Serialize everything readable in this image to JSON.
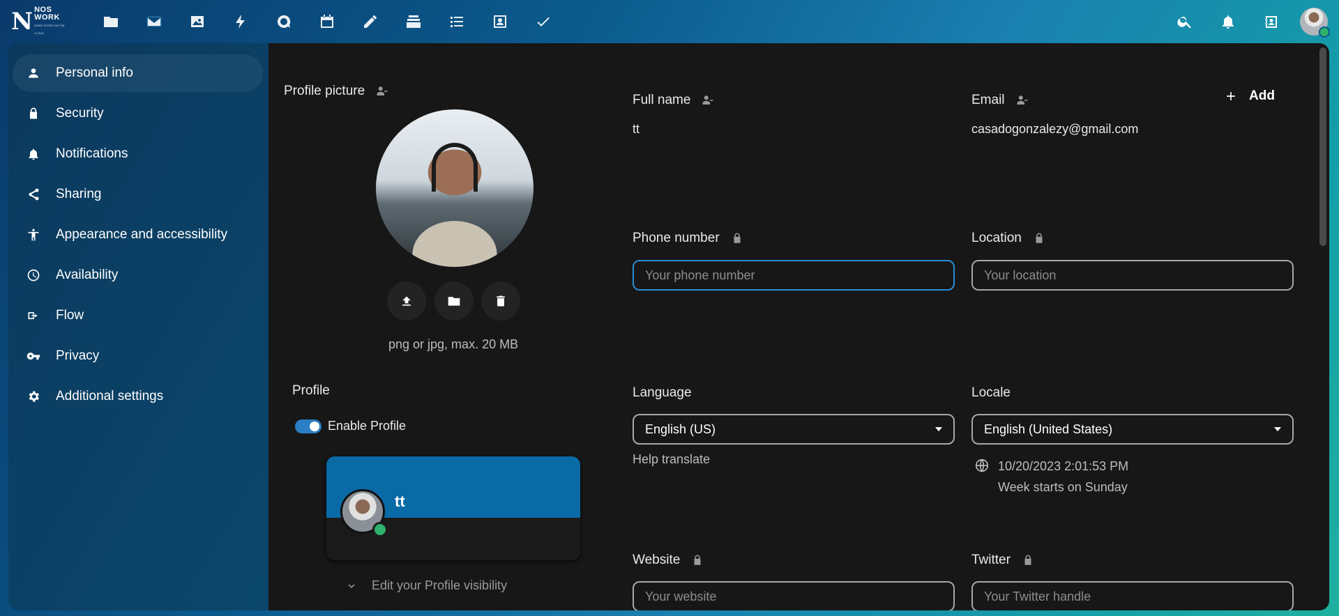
{
  "brand": {
    "logo_letter": "N",
    "logo_line1": "NOS",
    "logo_line2": "WORK",
    "logo_tagline": "WORK STORE ON THE CLOUD"
  },
  "top_apps": [
    "files-icon",
    "mail-icon",
    "photos-icon",
    "activity-icon",
    "talk-icon",
    "calendar-icon",
    "notes-icon",
    "deck-icon",
    "tasks-icon",
    "contacts-icon",
    "checkmark-icon"
  ],
  "nav": {
    "items": [
      {
        "label": "Personal info",
        "icon": "person-icon"
      },
      {
        "label": "Security",
        "icon": "lock-icon"
      },
      {
        "label": "Notifications",
        "icon": "bell-icon"
      },
      {
        "label": "Sharing",
        "icon": "share-icon"
      },
      {
        "label": "Appearance and accessibility",
        "icon": "accessibility-icon"
      },
      {
        "label": "Availability",
        "icon": "clock-icon"
      },
      {
        "label": "Flow",
        "icon": "flow-icon"
      },
      {
        "label": "Privacy",
        "icon": "key-icon"
      },
      {
        "label": "Additional settings",
        "icon": "gear-icon"
      }
    ]
  },
  "profile_picture": {
    "label": "Profile picture",
    "hint": "png or jpg, max. 20 MB"
  },
  "profile": {
    "label": "Profile",
    "enable_label": "Enable Profile",
    "enabled": true,
    "card_name": "tt",
    "edit_visibility": "Edit your Profile visibility"
  },
  "fields": {
    "fullname": {
      "label": "Full name",
      "value": "tt"
    },
    "email": {
      "label": "Email",
      "value": "casadogonzalezy@gmail.com",
      "add_label": "Add"
    },
    "phone": {
      "label": "Phone number",
      "placeholder": "Your phone number"
    },
    "location": {
      "label": "Location",
      "placeholder": "Your location"
    },
    "language": {
      "label": "Language",
      "value": "English (US)",
      "help": "Help translate"
    },
    "locale": {
      "label": "Locale",
      "value": "English (United States)",
      "datetime": "10/20/2023 2:01:53 PM",
      "week_start": "Week starts on Sunday"
    },
    "website": {
      "label": "Website",
      "placeholder": "Your website"
    },
    "twitter": {
      "label": "Twitter",
      "placeholder": "Your Twitter handle"
    }
  },
  "colors": {
    "accent": "#2a8dd4",
    "status_online": "#2fb16b",
    "banner": "#0a6aa6",
    "content_bg": "#171717"
  }
}
